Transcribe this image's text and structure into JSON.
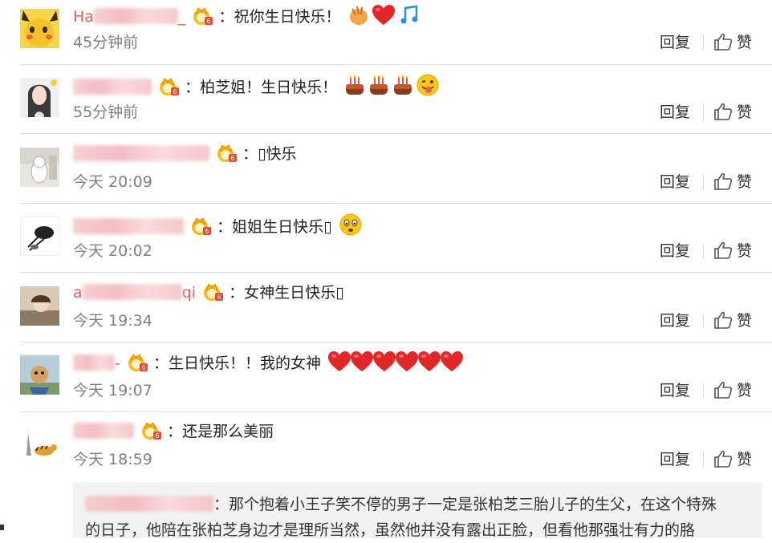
{
  "comments": [
    {
      "name_prefix": "Ha",
      "name_suffix": "_",
      "text": "：祝你生日快乐！",
      "time": "45分钟前"
    },
    {
      "name_prefix": "",
      "name_suffix": "",
      "text": "：柏芝姐！生日快乐！",
      "time": "55分钟前"
    },
    {
      "name_prefix": "",
      "name_suffix": "",
      "text": "：▯快乐",
      "time": "今天 20:09"
    },
    {
      "name_prefix": "",
      "name_suffix": "",
      "text": "：姐姐生日快乐▯",
      "time": "今天 20:02"
    },
    {
      "name_prefix": "a",
      "name_suffix": "qi",
      "text": "：女神生日快乐▯",
      "time": "今天 19:34"
    },
    {
      "name_prefix": "",
      "name_suffix": "-",
      "text": "：生日快乐！！我的女神",
      "time": "今天 19:07"
    },
    {
      "name_prefix": "",
      "name_suffix": "",
      "text": "：还是那么美丽",
      "time": "今天 18:59"
    }
  ],
  "actions": {
    "reply": "回复",
    "like": "赞"
  },
  "quoted_reply": {
    "text_line1": "：那个抱着小王子笑不停的男子一定是张柏芝三胎儿子的生父，在这个特殊",
    "text_line2": "的日子，他陪在张柏芝身边才是理所当然，虽然他并没有露出正脸，但看他那强壮有力的胳"
  },
  "colors": {
    "heart": "#e02828",
    "note": "#2f8fd8",
    "crown": "#f5b400",
    "time": "#808080",
    "quote_bg": "#f2f2f2"
  },
  "icons": [
    "crown-badge-icon",
    "thumbs-up-icon",
    "clap-emoji-icon",
    "heart-emoji-icon",
    "music-note-icon",
    "cake-emoji-icon",
    "tongue-face-emoji-icon",
    "worried-face-emoji-icon"
  ]
}
